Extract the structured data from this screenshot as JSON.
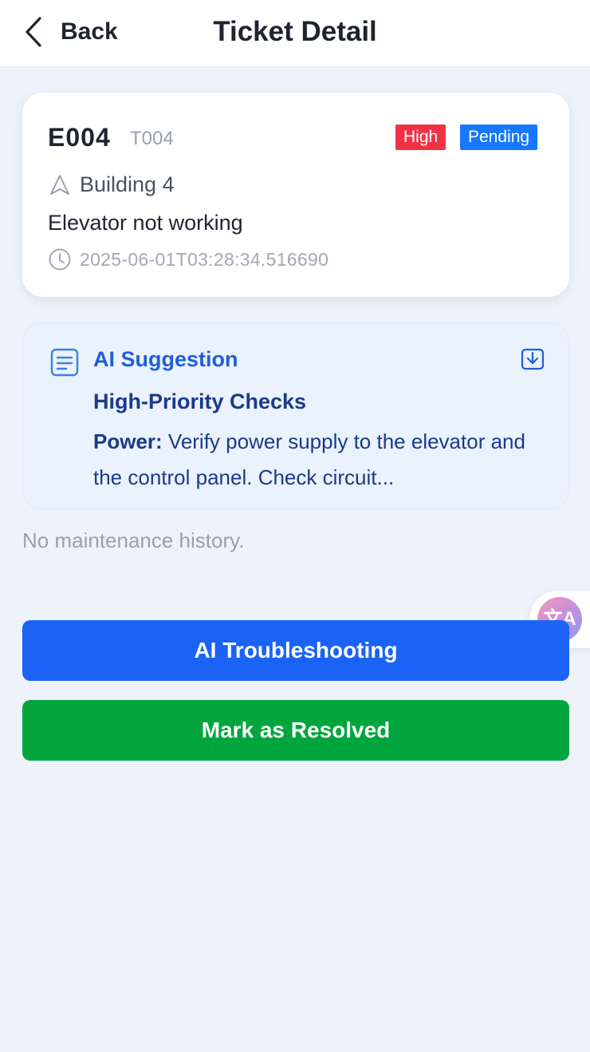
{
  "header": {
    "back_label": "Back",
    "title": "Ticket Detail"
  },
  "ticket": {
    "id": "E004",
    "code": "T004",
    "priority": "High",
    "status": "Pending",
    "location": "Building 4",
    "description": "Elevator not working",
    "timestamp": "2025-06-01T03:28:34.516690"
  },
  "ai_suggestion": {
    "title": "AI Suggestion",
    "heading": "High-Priority Checks",
    "body_label": "Power:",
    "body_text": " Verify power supply to the elevator and the control panel. Check circuit..."
  },
  "history": {
    "empty_text": "No maintenance history."
  },
  "translate_fab": {
    "glyph": "文A"
  },
  "actions": {
    "troubleshoot_label": "AI Troubleshooting",
    "resolve_label": "Mark as Resolved"
  },
  "colors": {
    "primary": "#1a63f5",
    "success": "#00a63d",
    "priority_high": "#f03344",
    "status_pending": "#1677ff",
    "page_background": "#eef3fb"
  },
  "icons": {
    "back": "chevron-left-icon",
    "location": "navigation-arrow-icon",
    "time": "clock-icon",
    "ai": "document-icon",
    "download": "download-icon",
    "translate": "translate-icon"
  }
}
